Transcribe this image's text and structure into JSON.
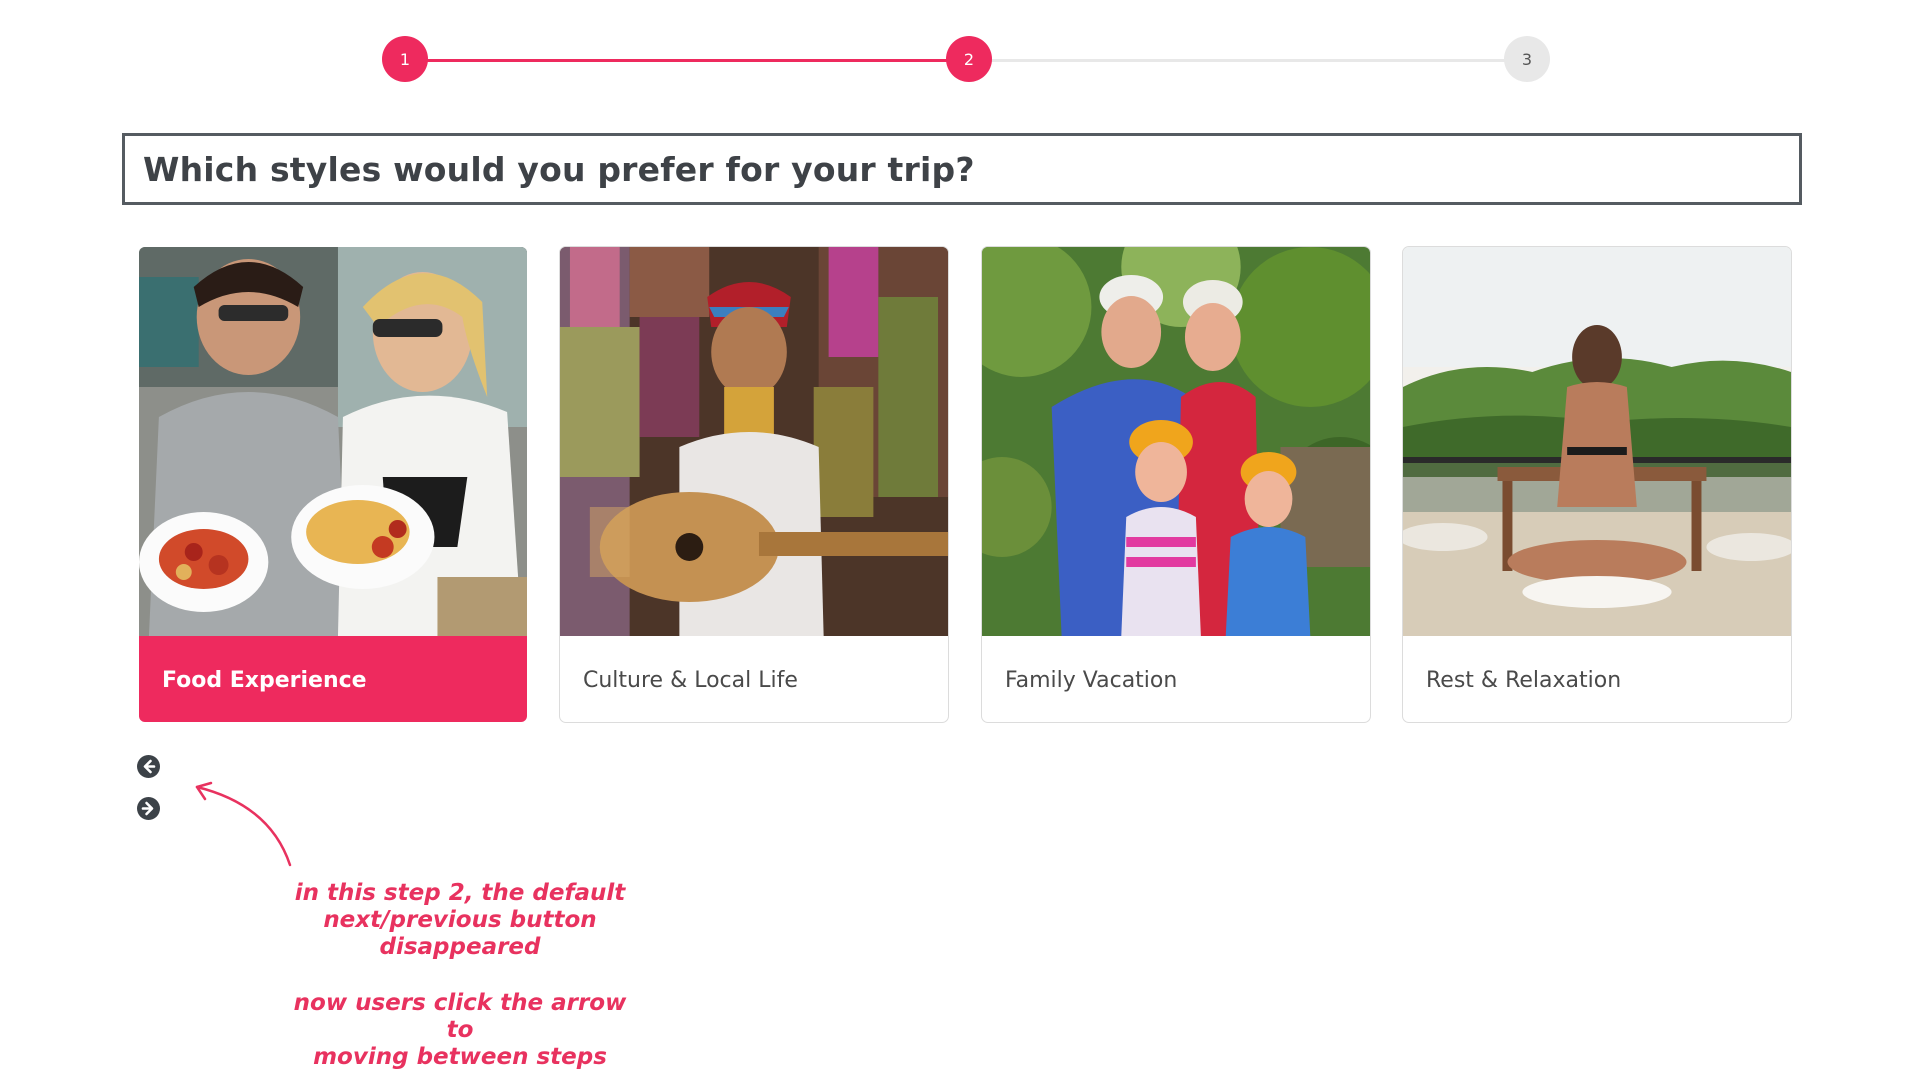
{
  "colors": {
    "accent": "#ee2a5e",
    "inactive_step": "#e8e8e8",
    "inactive_step_text": "#555555",
    "arrow": "#3c4248",
    "annotation": "#e8325f"
  },
  "stepper": {
    "steps": [
      {
        "label": "1",
        "state": "done"
      },
      {
        "label": "2",
        "state": "active"
      },
      {
        "label": "3",
        "state": "todo"
      }
    ]
  },
  "question": {
    "title": "Which styles would you prefer for your trip?"
  },
  "options": [
    {
      "label": "Food Experience",
      "selected": true,
      "photo": "couple-holding-food-plates"
    },
    {
      "label": "Culture & Local Life",
      "selected": false,
      "photo": "woman-playing-guitar-with-textiles"
    },
    {
      "label": "Family Vacation",
      "selected": false,
      "photo": "family-in-helmets-in-forest"
    },
    {
      "label": "Rest & Relaxation",
      "selected": false,
      "photo": "woman-meditating-on-terrace"
    }
  ],
  "navigation": {
    "prev_icon": "arrow-left-circle-icon",
    "next_icon": "arrow-right-circle-icon"
  },
  "annotation": {
    "line1": "in this step 2, the default",
    "line2": "next/previous button",
    "line3": "disappeared",
    "line4": "now users click the arrow to",
    "line5": "moving between steps"
  }
}
